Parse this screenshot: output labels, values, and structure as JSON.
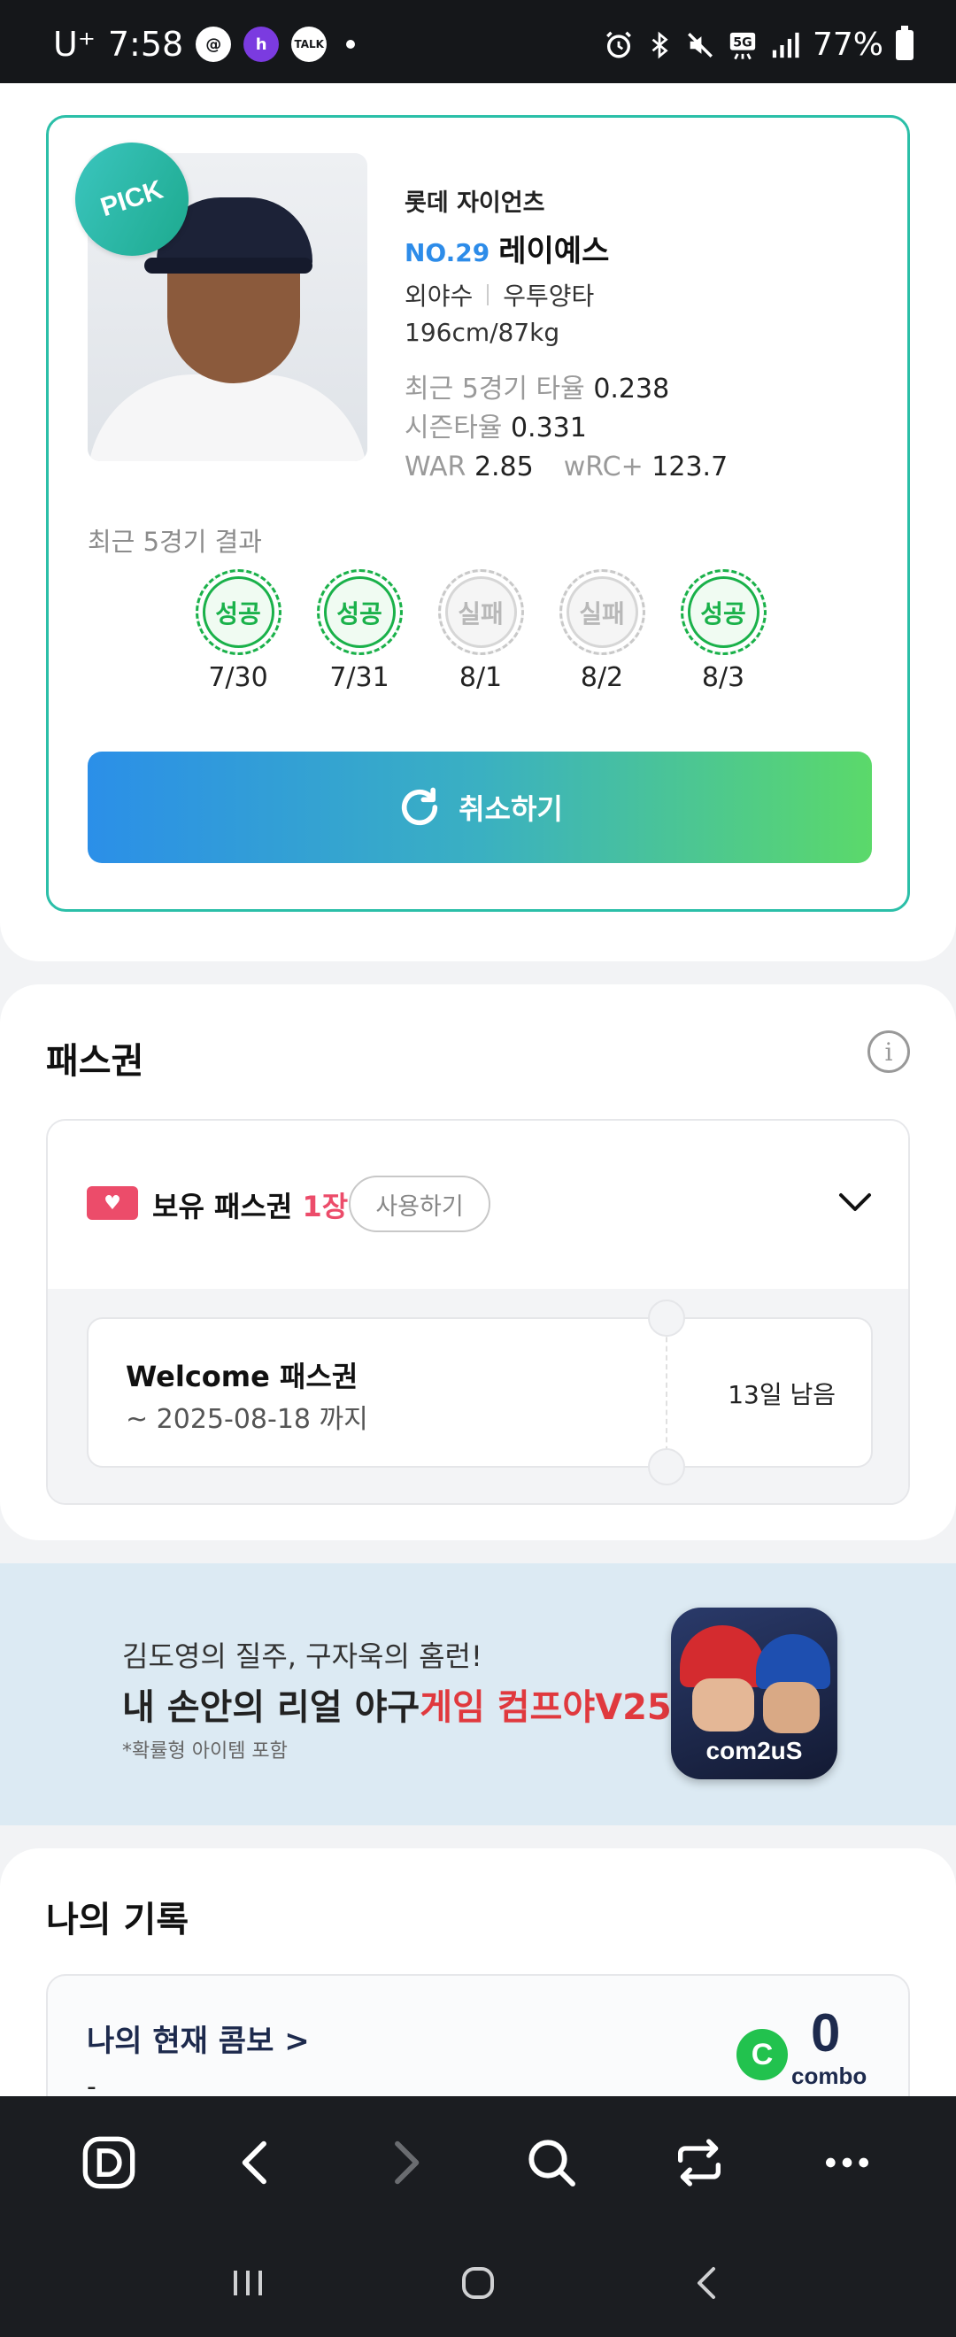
{
  "status_bar": {
    "carrier": "U⁺",
    "time": "7:58",
    "battery": "77%",
    "notification_icons": [
      "thread-icon",
      "h-app-icon",
      "talk-icon"
    ],
    "system_icons": [
      "alarm-icon",
      "bluetooth-icon",
      "mute-icon",
      "5g-icon",
      "signal-icon",
      "battery-icon"
    ]
  },
  "player": {
    "badge": "PICK",
    "team": "롯데 자이언츠",
    "number": "NO.29",
    "name": "레이예스",
    "position": "외야수",
    "bats": "우투양타",
    "body": "196cm/87kg",
    "recent_avg_label": "최근 5경기 타율",
    "recent_avg": "0.238",
    "season_avg_label": "시즌타율",
    "season_avg": "0.331",
    "war_label": "WAR",
    "war": "2.85",
    "wrc_label": "wRC+",
    "wrc": "123.7"
  },
  "recent_results": {
    "label": "최근 5경기 결과",
    "items": [
      {
        "result": "성공",
        "date": "7/30",
        "status": "success"
      },
      {
        "result": "성공",
        "date": "7/31",
        "status": "success"
      },
      {
        "result": "실패",
        "date": "8/1",
        "status": "fail"
      },
      {
        "result": "실패",
        "date": "8/2",
        "status": "fail"
      },
      {
        "result": "성공",
        "date": "8/3",
        "status": "success"
      }
    ]
  },
  "cancel_button": {
    "label": "취소하기"
  },
  "pass": {
    "title": "패스권",
    "owned_label": "보유 패스권",
    "owned_count": "1장",
    "use_button": "사용하기",
    "ticket_name": "Welcome 패스권",
    "ticket_expiry": "~ 2025-08-18 까지",
    "days_left": "13일 남음"
  },
  "ad": {
    "line1": "김도영의 질주, 구자욱의 홈런!",
    "line2_a": "내 손안의 리얼 야구",
    "line2_b": "게임 컴프야V25",
    "line3": "*확률형 아이템 포함",
    "app_brand": "com2uS"
  },
  "records": {
    "title": "나의 기록",
    "combo_title": "나의 현재 콤보 >",
    "combo_sub": "-",
    "combo_value": "0",
    "combo_unit": "combo",
    "combo_icon": "C"
  },
  "colors": {
    "accent_teal": "#2bbfa8",
    "number_blue": "#2d8ce9",
    "success_green": "#1ab14a",
    "pass_pink": "#ec4c6a",
    "ad_red": "#e0393e"
  }
}
